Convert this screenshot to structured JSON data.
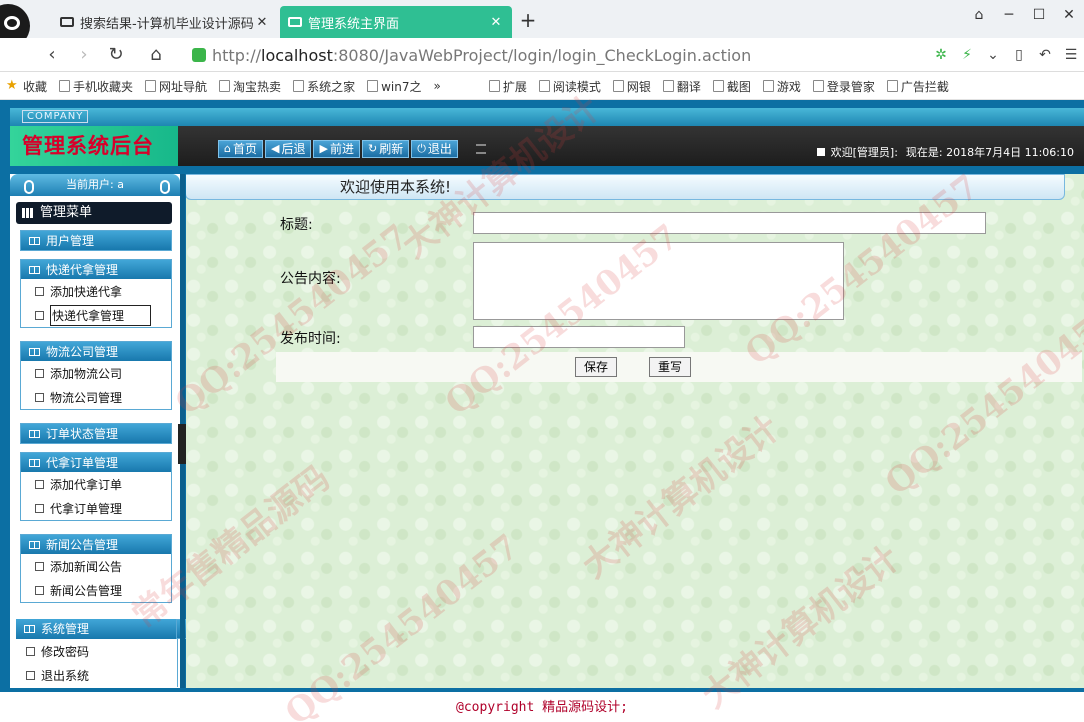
{
  "browser": {
    "tabs": [
      {
        "label": "搜索结果-计算机毕业设计源码网",
        "active": false
      },
      {
        "label": "管理系统主界面",
        "active": true
      }
    ],
    "new_tab": "+",
    "window_controls": [
      "⌂",
      "─",
      "☐",
      "✕"
    ],
    "url": {
      "prefix": "http://",
      "host": "localhost",
      "rest": ":8080/JavaWebProject/login/login_CheckLogin.action"
    },
    "bookmarks": [
      "收藏",
      "手机收藏夹",
      "网址导航",
      "淘宝热卖",
      "系统之家",
      "win7之",
      "»"
    ],
    "toolbar_right": [
      "扩展",
      "阅读模式",
      "网银",
      "翻译",
      "截图",
      "游戏",
      "登录管家",
      "广告拦截"
    ]
  },
  "header": {
    "company": "COMPANY",
    "title": "管理系统后台",
    "buttons": [
      {
        "icon": "home-icon",
        "glyph": "⌂",
        "label": "首页"
      },
      {
        "icon": "back-icon",
        "glyph": "◀",
        "label": "后退"
      },
      {
        "icon": "forward-icon",
        "glyph": "▶",
        "label": "前进"
      },
      {
        "icon": "refresh-icon",
        "glyph": "↻",
        "label": "刷新"
      },
      {
        "icon": "power-icon",
        "glyph": "⏻",
        "label": "退出"
      }
    ],
    "welcome": "欢迎[管理员]:",
    "now_label": "现在是: 2018年7月4日 11:06:10"
  },
  "sidebar": {
    "current_user": "当前用户: a",
    "menu_title": "管理菜单",
    "groups": [
      {
        "title": "用户管理",
        "items": []
      },
      {
        "title": "快递代拿管理",
        "items": [
          "添加快递代拿",
          "快递代拿管理"
        ]
      },
      {
        "title": "物流公司管理",
        "items": [
          "添加物流公司",
          "物流公司管理"
        ]
      },
      {
        "title": "订单状态管理",
        "items": []
      },
      {
        "title": "代拿订单管理",
        "items": [
          "添加代拿订单",
          "代拿订单管理"
        ]
      },
      {
        "title": "新闻公告管理",
        "items": [
          "添加新闻公告",
          "新闻公告管理"
        ]
      }
    ],
    "system": {
      "title": "系统管理",
      "items": [
        "修改密码",
        "退出系统"
      ]
    }
  },
  "main": {
    "welcome": "欢迎使用本系统!",
    "form": {
      "title_label": "标题:",
      "title_value": "",
      "content_label": "公告内容:",
      "content_value": "",
      "date_label": "发布时间:",
      "date_value": "",
      "save": "保存",
      "reset": "重写"
    }
  },
  "footer": {
    "copyright": "@copyright 精品源码设计;"
  },
  "watermarks": [
    "QQ:254540457",
    "常年售精品源码",
    "大神计算机设计"
  ]
}
